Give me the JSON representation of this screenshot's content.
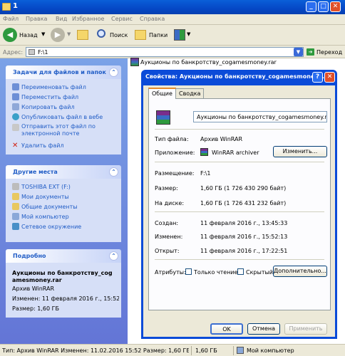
{
  "window": {
    "title": "1",
    "minimize": "_",
    "maximize": "□",
    "close": "✕"
  },
  "menu": [
    "Файл",
    "Правка",
    "Вид",
    "Избранное",
    "Сервис",
    "Справка"
  ],
  "toolbar": {
    "back": "Назад",
    "search": "Поиск",
    "folders": "Папки"
  },
  "address": {
    "label": "Адрес:",
    "value": "F:\\1",
    "go": "Переход"
  },
  "tasks_panel": {
    "title": "Задачи для файлов и папок",
    "items": [
      "Переименовать файл",
      "Переместить файл",
      "Копировать файл",
      "Опубликовать файл в вебе",
      "Отправить этот файл по электронной почте",
      "Удалить файл"
    ]
  },
  "places_panel": {
    "title": "Другие места",
    "items": [
      "TOSHIBA EXT (F:)",
      "Мои документы",
      "Общие документы",
      "Мой компьютер",
      "Сетевое окружение"
    ]
  },
  "details_panel": {
    "title": "Подробно",
    "name": "Аукционы по банкротству_cogamesmoney.rar",
    "type": "Архив WinRAR",
    "modified": "Изменен: 11 февраля 2016 г., 15:52",
    "size": "Размер: 1,60 ГБ"
  },
  "file_item": {
    "name": "Аукционы по банкротству_cogamesmoney.rar"
  },
  "dialog": {
    "title": "Свойства: Аукционы по банкротству_cogamesmoney...",
    "help_btn": "?",
    "close_btn": "✕",
    "tabs": [
      "Общие",
      "Сводка"
    ],
    "filename": "Аукционы по банкротству_cogamesmoney.rar",
    "type_label": "Тип файла:",
    "type_value": "Архив WinRAR",
    "app_label": "Приложение:",
    "app_value": "WinRAR archiver",
    "change_btn": "Изменить...",
    "location_label": "Размещение:",
    "location_value": "F:\\1",
    "size_label": "Размер:",
    "size_value": "1,60 ГБ (1 726 430 290 байт)",
    "disk_label": "На диске:",
    "disk_value": "1,60 ГБ (1 726 431 232 байт)",
    "created_label": "Создан:",
    "created_value": "11 февраля 2016 г., 13:45:33",
    "modified_label": "Изменен:",
    "modified_value": "11 февраля 2016 г., 15:52:13",
    "opened_label": "Открыт:",
    "opened_value": "11 февраля 2016 г., 17:22:51",
    "attrs_label": "Атрибуты:",
    "readonly_label": "Только чтение",
    "hidden_label": "Скрытый",
    "advanced_btn": "Дополнительно...",
    "ok": "OK",
    "cancel": "Отмена",
    "apply": "Применить"
  },
  "status": {
    "left": "Тип: Архив WinRAR Изменен: 11.02.2016 15:52 Размер: 1,60 ГБ",
    "size": "1,60 ГБ",
    "location": "Мой компьютер"
  }
}
